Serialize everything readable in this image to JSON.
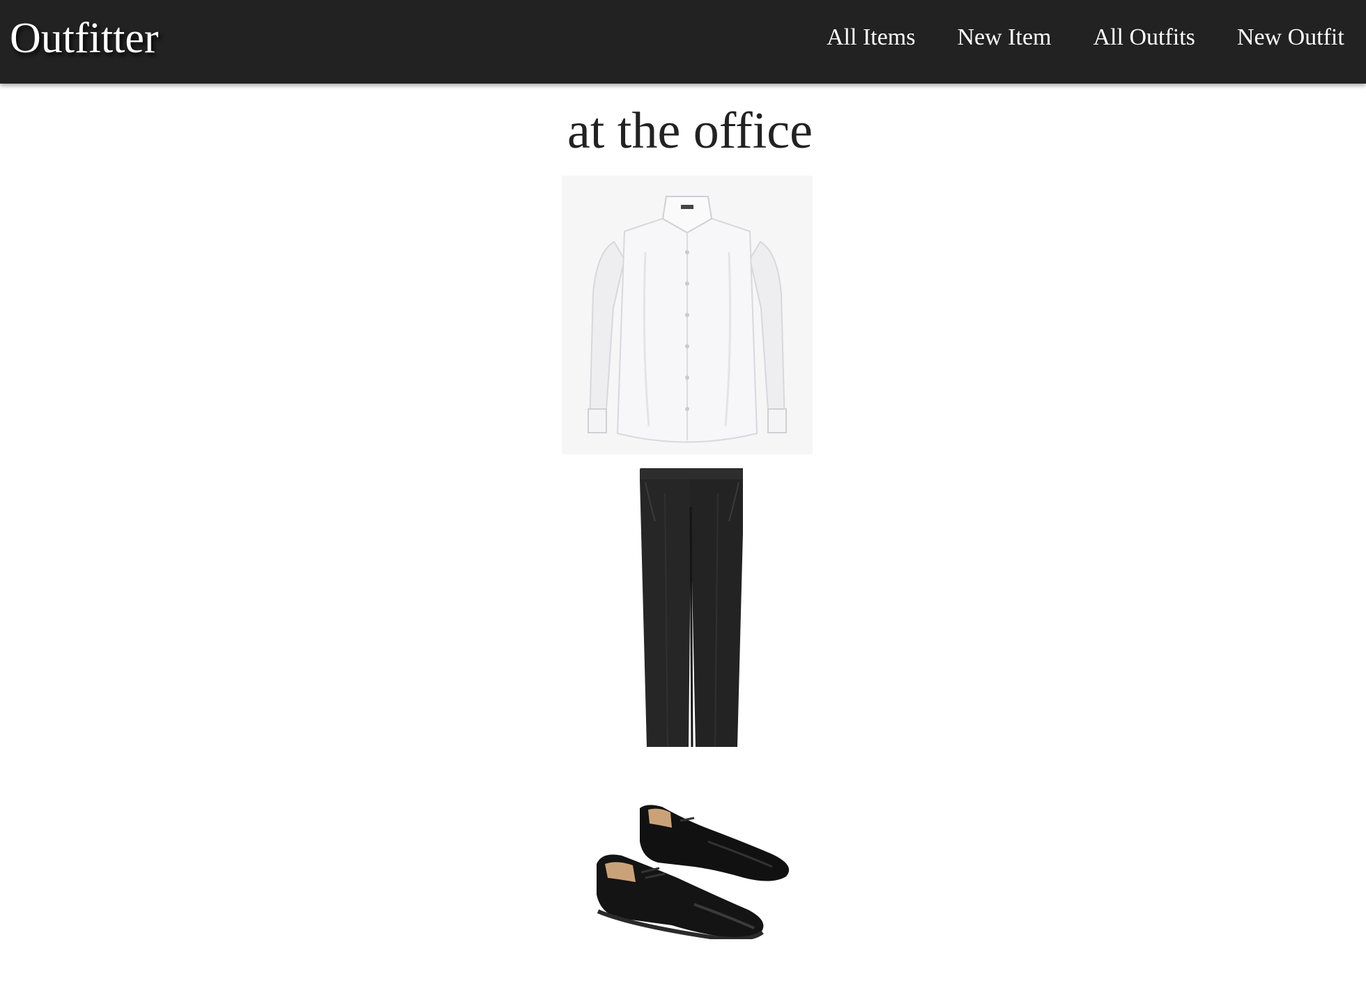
{
  "navbar": {
    "brand": "Outfitter",
    "links": [
      {
        "label": "All Items"
      },
      {
        "label": "New Item"
      },
      {
        "label": "All Outfits"
      },
      {
        "label": "New Outfit"
      }
    ]
  },
  "outfit": {
    "title": "at the office",
    "items": [
      {
        "icon": "shirt-icon",
        "color": "#f2f2f4"
      },
      {
        "icon": "pants-icon",
        "color": "#262626"
      },
      {
        "icon": "shoes-icon",
        "color": "#121212"
      }
    ]
  },
  "colors": {
    "navbar_bg": "#222222",
    "nav_text": "#ffffff",
    "page_bg": "#ffffff",
    "title_text": "#222222"
  }
}
